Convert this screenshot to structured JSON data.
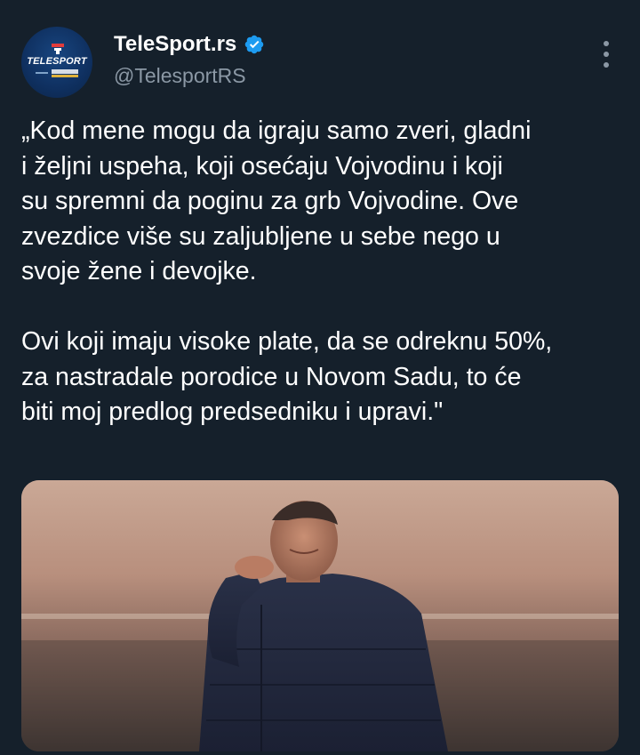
{
  "account": {
    "display_name": "TeleSport.rs",
    "handle": "@TelesportRS",
    "verified": true,
    "avatar_text": "TELESPORT"
  },
  "tweet": {
    "text": "„Kod mene mogu da igraju samo zveri, gladni\ni željni uspeha, koji osećaju Vojvodinu i koji\nsu spremni da poginu za grb Vojvodine. Ove\nzvezdice više su zaljubljene u sebe nego u\nsvoje žene i devojke.\n\nOvi koji imaju visoke plate, da se odreknu 50%,\nza nastradale porodice u Novom Sadu, to će\nbiti moj predlog predsedniku i upravi.\""
  },
  "icons": {
    "verified": "verified-badge-icon",
    "more": "more-options-icon"
  },
  "colors": {
    "background": "#15202b",
    "text_primary": "#ffffff",
    "text_secondary": "#8b98a5",
    "verified_blue": "#1d9bf0"
  }
}
